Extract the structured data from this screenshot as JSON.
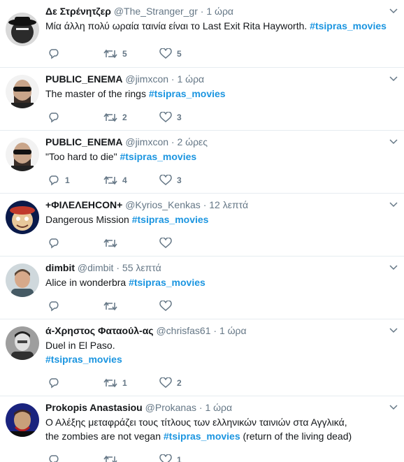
{
  "tweets": [
    {
      "name": "Δε Στρένητζερ",
      "handle": "@The_Stranger_gr",
      "dot": "·",
      "time": "1 ώρα",
      "text": "Μία άλλη πολύ ωραία ταινία είναι το Last Exit Rita Hayworth. ",
      "hashtag": "#tsipras_movies",
      "replies": "",
      "retweets": "5",
      "likes": "5"
    },
    {
      "name": "PUBLIC_ENEMA",
      "handle": "@jimxcon",
      "dot": "·",
      "time": "1 ώρα",
      "text": "The master of the rings ",
      "hashtag": "#tsipras_movies",
      "replies": "",
      "retweets": "2",
      "likes": "3"
    },
    {
      "name": "PUBLIC_ENEMA",
      "handle": "@jimxcon",
      "dot": "·",
      "time": "2 ώρες",
      "text": "\"Too hard to die\" ",
      "hashtag": "#tsipras_movies",
      "replies": "1",
      "retweets": "4",
      "likes": "3"
    },
    {
      "name": "+ΦΙΛΕΛΕΗCON+",
      "handle": "@Kyrios_Kenkas",
      "dot": "·",
      "time": "12 λεπτά",
      "text": "Dangerous Mission ",
      "hashtag": "#tsipras_movies",
      "replies": "",
      "retweets": "",
      "likes": ""
    },
    {
      "name": "dimbit",
      "handle": "@dimbit",
      "dot": "·",
      "time": "55 λεπτά",
      "text": "Alice in wonderbra ",
      "hashtag": "#tsipras_movies",
      "replies": "",
      "retweets": "",
      "likes": ""
    },
    {
      "name": "ά-Χρηστος Φαταούλ-ας",
      "handle": "@chrisfas61",
      "dot": "·",
      "time": "1 ώρα",
      "text": "Duel in El Paso.",
      "text2": "",
      "hashtag": "#tsipras_movies",
      "replies": "",
      "retweets": "1",
      "likes": "2"
    },
    {
      "name": "Prokopis Anastasiou",
      "handle": "@Prokanas",
      "dot": "·",
      "time": "1 ώρα",
      "text": "Ο Αλέξης μεταφράζει τους τίτλους των ελληνικών ταινιών στα Αγγλικά,",
      "text2": "the zombies are not vegan ",
      "hashtag": "#tsipras_movies",
      "text3": " (return of the living dead)",
      "replies": "",
      "retweets": "",
      "likes": "1"
    }
  ],
  "icons": {
    "reply": "reply-icon",
    "retweet": "retweet-icon",
    "like": "heart-icon",
    "caret": "chevron-down-icon"
  },
  "colors": {
    "hashtag": "#1b95e0",
    "muted": "#657786",
    "divider": "#e6ecf0"
  }
}
